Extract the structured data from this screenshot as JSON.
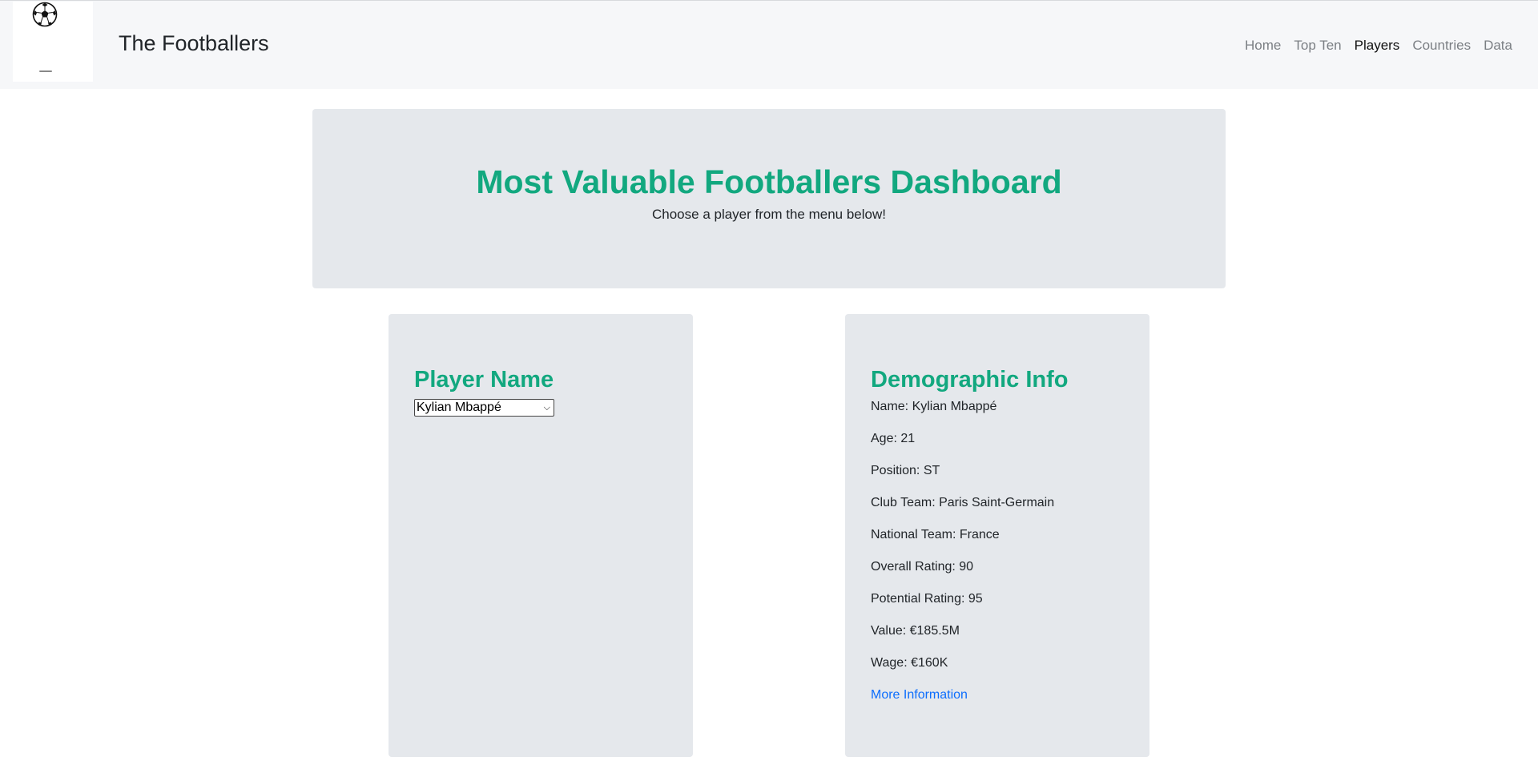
{
  "navbar": {
    "logo_icon": "soccer-ball-icon",
    "title": "The Footballers",
    "links": [
      {
        "label": "Home",
        "active": false
      },
      {
        "label": "Top Ten",
        "active": false
      },
      {
        "label": "Players",
        "active": true
      },
      {
        "label": "Countries",
        "active": false
      },
      {
        "label": "Data",
        "active": false
      }
    ]
  },
  "jumbotron": {
    "title": "Most Valuable Footballers Dashboard",
    "lead": "Choose a player from the menu below!"
  },
  "player_card": {
    "heading": "Player Name",
    "selected_player": "Kylian Mbappé"
  },
  "demographic_card": {
    "heading": "Demographic Info",
    "lines": [
      "Name: Kylian Mbappé",
      "Age: 21",
      "Position: ST",
      "Club Team: Paris Saint-Germain",
      "National Team: France",
      "Overall Rating: 90",
      "Potential Rating: 95",
      "Value: €185.5M",
      "Wage: €160K"
    ],
    "more_link": "More Information"
  },
  "colors": {
    "accent_green": "#12a87f",
    "panel_bg": "#e5e8ec",
    "navbar_bg": "#f6f7f9",
    "link_blue": "#0d6efd"
  }
}
